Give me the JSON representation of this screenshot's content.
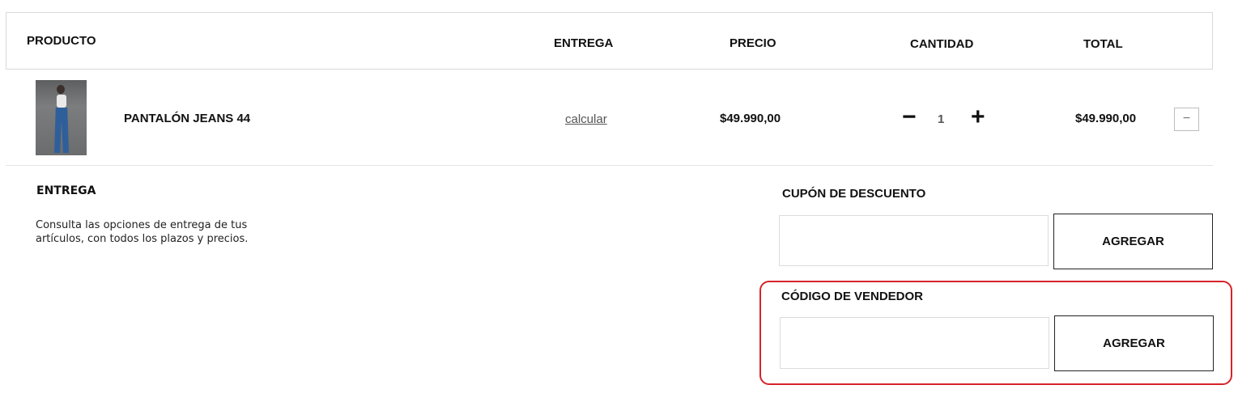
{
  "table": {
    "headers": {
      "product": "PRODUCTO",
      "delivery": "ENTREGA",
      "price": "PRECIO",
      "quantity": "CANTIDAD",
      "total": "TOTAL"
    },
    "item": {
      "name": "PANTALÓN JEANS 44",
      "delivery_link": "calcular",
      "price": "$49.990,00",
      "quantity": "1",
      "decrement": "−",
      "increment": "+",
      "total": "$49.990,00",
      "remove": "−"
    }
  },
  "delivery_section": {
    "title": "ENTREGA",
    "description_line1": "Consulta las opciones de entrega de tus",
    "description_line2": "artículos, con todos los plazos y precios."
  },
  "coupon": {
    "title": "CUPÓN DE DESCUENTO",
    "input_value": "",
    "button_label": "AGREGAR"
  },
  "seller_code": {
    "title": "CÓDIGO DE VENDEDOR",
    "input_value": "",
    "button_label": "AGREGAR"
  },
  "colors": {
    "highlight": "#d6232a",
    "border": "#d9d9d9",
    "text": "#111111"
  }
}
